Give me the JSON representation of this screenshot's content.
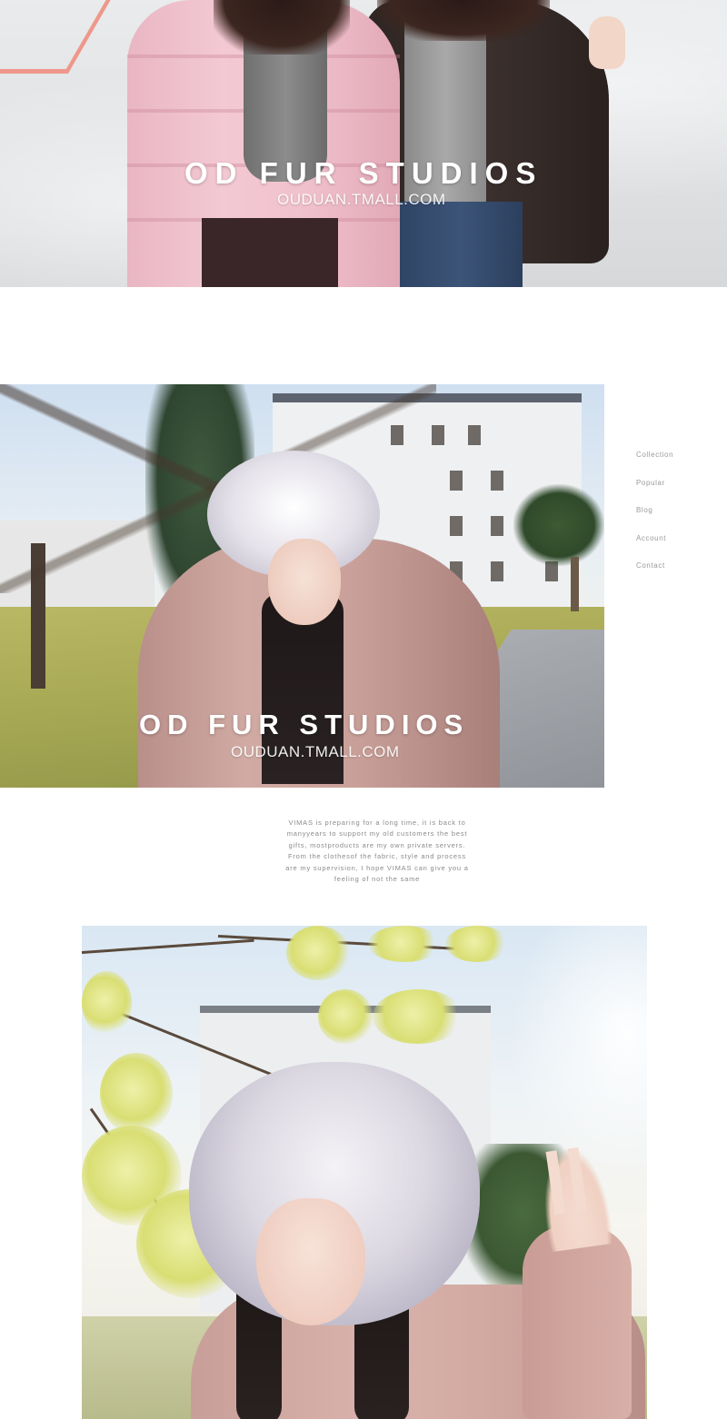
{
  "brand": {
    "title": "OD FUR STUDIOS",
    "url": "OUDUAN.TMALL.COM"
  },
  "side_nav": {
    "items": [
      {
        "label": "Collection"
      },
      {
        "label": "Popular"
      },
      {
        "label": "Blog"
      },
      {
        "label": "Account"
      },
      {
        "label": "Contact"
      }
    ]
  },
  "description": {
    "lines": [
      "VIMAS is preparing for a long time, it is back to",
      "manyyears to support my old customers the best",
      "gifts, mostproducts are my own private servers.",
      "From the clothesof the fabric, style and process",
      "are my supervision, I hope VIMAS can give you a",
      "feeling of not the same"
    ]
  },
  "colors": {
    "background": "#ffffff",
    "nav_text": "#9a9a9a",
    "body_text": "#8a8a8a",
    "overlay_text": "#ffffff"
  }
}
